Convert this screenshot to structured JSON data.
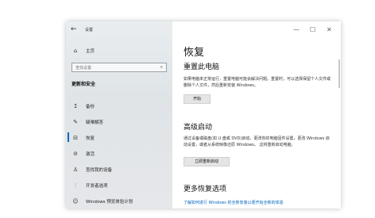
{
  "window": {
    "title": "设置"
  },
  "titlebar": {
    "back": "←",
    "minimize": "—",
    "maximize": "☐",
    "close": "✕"
  },
  "sidebar": {
    "home_label": "主页",
    "search_placeholder": "查找设置",
    "section": "更新和安全",
    "items": [
      {
        "label": "备份"
      },
      {
        "label": "疑难解答"
      },
      {
        "label": "恢复"
      },
      {
        "label": "激活"
      },
      {
        "label": "查找我的设备"
      },
      {
        "label": "开发者选项"
      },
      {
        "label": "Windows 预览体验计划"
      }
    ]
  },
  "main": {
    "title": "恢复",
    "reset": {
      "heading": "重置此电脑",
      "desc": "如果电脑未正常运行，重置电脑可能会解决问题。重置时，可以选择保留个人文件或删除个人文件，然后重新安装 Windows。",
      "button": "开始"
    },
    "advanced": {
      "heading": "高级启动",
      "desc": "通过设备或磁盘(如 U 盘或 DVD)启动，更改你的电脑固件设置，更改 Windows 启动设置，或者从系统映像还原 Windows。 这将重新启动电脑。",
      "button": "立即重新启动"
    },
    "more": {
      "heading": "更多恢复选项",
      "link": "了解如何进行 Windows 的全新安装以便开始全新的体验"
    }
  }
}
